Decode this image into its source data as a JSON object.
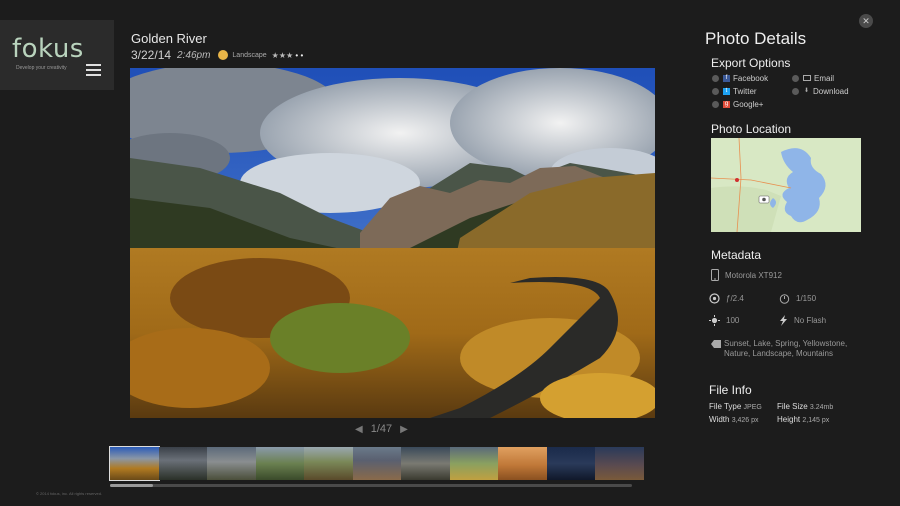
{
  "brand": {
    "name": "fokus",
    "tagline": "Develop your creativity"
  },
  "photo": {
    "title": "Golden River",
    "date": "3/22/14",
    "time": "2:46pm",
    "category": "Landscape",
    "rating": 3,
    "rating_max": 5
  },
  "pager": {
    "prev": "◀",
    "current": "1/47",
    "next": "▶"
  },
  "copyright": "© 2014 fokus, inc. All rights reserved.",
  "close_label": "✕",
  "panel": {
    "title": "Photo Details",
    "export": {
      "title": "Export Options",
      "options": [
        {
          "label": "Facebook"
        },
        {
          "label": "Email"
        },
        {
          "label": "Twitter"
        },
        {
          "label": "Download"
        },
        {
          "label": "Google+"
        }
      ]
    },
    "location": {
      "title": "Photo Location"
    },
    "metadata": {
      "title": "Metadata",
      "device": "Motorola XT912",
      "aperture": "ƒ/2.4",
      "shutter": "1/150",
      "iso": "100",
      "flash": "No Flash",
      "tags": "Sunset, Lake, Spring, Yellowstone, Nature, Landscape, Mountains"
    },
    "file_info": {
      "title": "File Info",
      "type_label": "File Type",
      "type_value": "JPEG",
      "size_label": "File Size",
      "size_value": "3.24mb",
      "width_label": "Width",
      "width_value": "3,426 px",
      "height_label": "Height",
      "height_value": "2,145 px"
    }
  },
  "colors": {
    "background": "#1c1c1c",
    "logo_green": "#b9d3bd",
    "category_dot": "#e8b548"
  }
}
